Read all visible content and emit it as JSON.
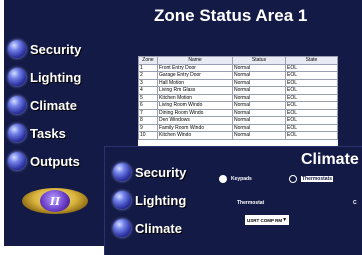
{
  "back_window": {
    "title": "Zone Status Area 1",
    "nav": [
      {
        "label": "Security",
        "icon": "orb-icon"
      },
      {
        "label": "Lighting",
        "icon": "orb-icon"
      },
      {
        "label": "Climate",
        "icon": "orb-icon"
      },
      {
        "label": "Tasks",
        "icon": "orb-icon"
      },
      {
        "label": "Outputs",
        "icon": "orb-icon"
      }
    ],
    "logo_text": "II",
    "table": {
      "headers": [
        "Zone",
        "Name",
        "Status",
        "State"
      ],
      "rows": [
        [
          "1",
          "Front Entry Door",
          "Normal",
          "EOL"
        ],
        [
          "2",
          "Garage Entry Door",
          "Normal",
          "EOL"
        ],
        [
          "3",
          "Hall Motion",
          "Normal",
          "EOL"
        ],
        [
          "4",
          "Living Rm Glass",
          "Normal",
          "EOL"
        ],
        [
          "5",
          "Kitchen Motion",
          "Normal",
          "EOL"
        ],
        [
          "6",
          "Living Room Windo",
          "Normal",
          "EOL"
        ],
        [
          "7",
          "Dining Room Windo",
          "Normal",
          "EOL"
        ],
        [
          "8",
          "Den Windows",
          "Normal",
          "EOL"
        ],
        [
          "9",
          "Family Room Windo",
          "Normal",
          "EOL"
        ],
        [
          "10",
          "Kitchen Windo",
          "Normal",
          "EOL"
        ]
      ]
    }
  },
  "front_window": {
    "title": "Climate",
    "nav": [
      {
        "label": "Security",
        "icon": "orb-icon"
      },
      {
        "label": "Lighting",
        "icon": "orb-icon"
      },
      {
        "label": "Climate",
        "icon": "orb-icon"
      }
    ],
    "radio_keypads": "Keypads",
    "radio_thermostats": "Thermostats",
    "thermostat_label": "Thermostat",
    "second_column_label": "C",
    "thermostat_select": "USRT COMP RM"
  },
  "colors": {
    "panel_bg": "#141a46",
    "orb": "#6f7fe8",
    "logo_gold": "#d9b33c"
  }
}
